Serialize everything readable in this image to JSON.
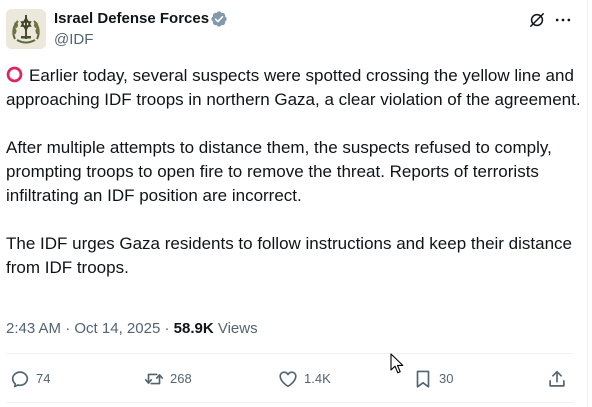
{
  "account": {
    "display_name": "Israel Defense Forces",
    "handle": "@IDF",
    "verified": true,
    "avatar_icon": "idf-emblem-avatar"
  },
  "header_icons": {
    "grok": "grok-icon",
    "more": "more-icon"
  },
  "tweet": {
    "lead_icon": "red-circle-icon",
    "paragraphs": [
      "Earlier today, several suspects were spotted crossing the yellow line and approaching IDF troops in northern Gaza, a clear violation of the agreement.",
      "After multiple attempts to distance them, the suspects refused to comply, prompting troops to open fire to remove the threat. Reports of terrorists infiltrating an IDF position are incorrect.",
      "The IDF urges Gaza residents to follow instructions and keep their distance from IDF troops."
    ]
  },
  "meta": {
    "time": "2:43 AM",
    "separator": "·",
    "date": "Oct 14, 2025",
    "views_count": "58.9K",
    "views_label": "Views"
  },
  "actions": {
    "replies": "74",
    "reposts": "268",
    "likes": "1.4K",
    "bookmarks": "30"
  },
  "colors": {
    "text": "#0f1419",
    "secondary": "#536471",
    "verified": "#829aab",
    "ring": "#e0245e",
    "divider": "#eff3f4"
  }
}
